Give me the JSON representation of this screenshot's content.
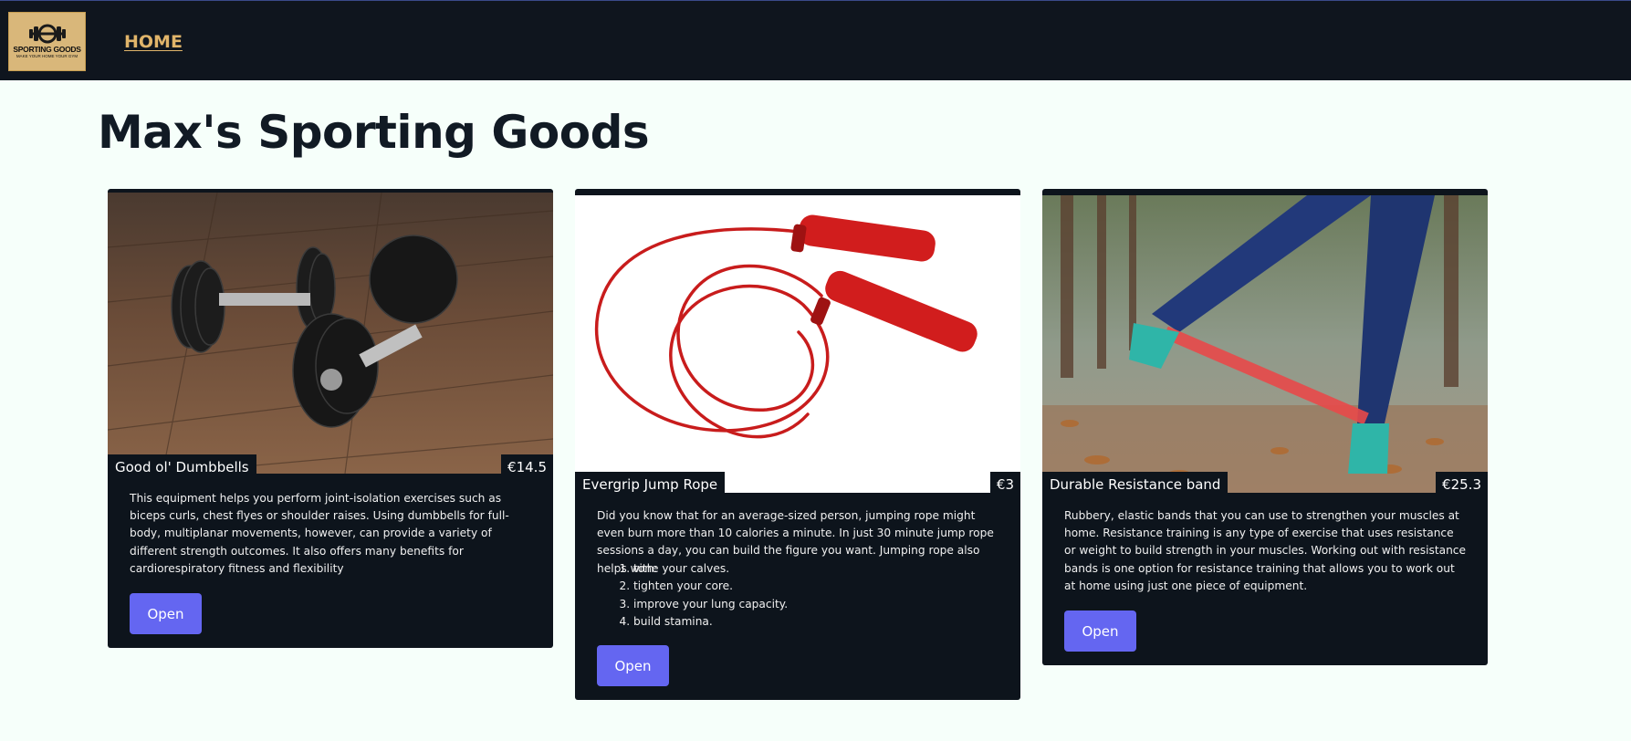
{
  "header": {
    "logo": {
      "title": "SPORTING GOODS",
      "subtitle": "MAKE YOUR HOME YOUR GYM"
    },
    "nav": {
      "home_label": "HOME"
    }
  },
  "page": {
    "title": "Max's Sporting Goods"
  },
  "products": [
    {
      "name": "Good ol' Dumbbells",
      "price": "€14.5",
      "description": "This equipment helps you perform joint-isolation exercises such as biceps curls, chest flyes or shoulder raises. Using dumbbells for full-body, multiplanar movements, however, can provide a variety of different strength outcomes. It also offers many benefits for cardiorespiratory fitness and flexibility",
      "image": "dumbbells-photo",
      "button": "Open"
    },
    {
      "name": "Evergrip Jump Rope",
      "price": "€3",
      "description": "Did you know that for an average-sized person, jumping rope might even burn more than 10 calories a minute. In just 30 minute jump rope sessions a day, you can build the figure you want. Jumping rope also helps with:",
      "benefits": [
        "tone your calves.",
        "tighten your core.",
        "improve your lung capacity.",
        "build stamina."
      ],
      "image": "jump-rope-photo",
      "button": "Open"
    },
    {
      "name": "Durable Resistance band",
      "price": "€25.3",
      "description": "Rubbery, elastic bands that you can use to strengthen your muscles at home. Resistance training is any type of exercise that uses resistance or weight to build strength in your muscles. Working out with resistance bands is one option for resistance training that allows you to work out at home using just one piece of equipment.",
      "image": "resistance-band-photo",
      "button": "Open"
    }
  ],
  "colors": {
    "header_bg": "#0f151e",
    "page_bg": "#f6fffa",
    "card_bg": "#0d141c",
    "nav_link": "#e0b46a",
    "button": "#6466f1",
    "title": "#111a24"
  }
}
